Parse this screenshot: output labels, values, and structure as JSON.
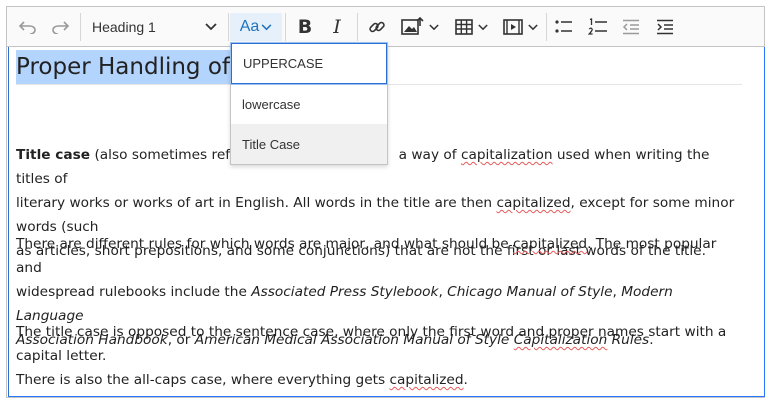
{
  "toolbar": {
    "undo_icon": "undo-icon",
    "redo_icon": "redo-icon",
    "heading_value": "Heading 1",
    "case_label": "Aa",
    "bold_label": "B",
    "italic_label": "I"
  },
  "case_menu": {
    "items": [
      {
        "label": "UPPERCASE"
      },
      {
        "label": "lowercase"
      },
      {
        "label": "Title Case"
      }
    ]
  },
  "document": {
    "title": "Proper Handling of T",
    "p1": {
      "bold": "Title case",
      "t1": " (also sometimes referre",
      "t2": "a way of ",
      "w_cap1": "capitalization",
      "t3": " used when writing the titles of",
      "t4": "literary works or works of art in English. All words in the title are then ",
      "w_cap2": "capitalized",
      "t5": ", except for some minor words (such",
      "t6": "as articles, short prepositions, and some conjunctions) that are not the first or last words of the title."
    },
    "p2": {
      "t1": "There are different rules for which words are major, and what should be ",
      "w_cap3": "capitalized",
      "t2": ". The most popular and",
      "t3": "widespread rulebooks include the ",
      "i1": "Associated Press Stylebook",
      "t4": ", ",
      "i2": "Chicago Manual of Style",
      "t5": ", ",
      "i3": "Modern Language",
      "i4": "Association Handbook",
      "t6": ", or ",
      "i5": "American Medical Association Manual of Style ",
      "i6": "Capitalization",
      "i7": " Rules",
      "t7": "."
    },
    "p3": {
      "t1": "The title case is opposed to the sentence case, where only the first word and proper names start with a capital letter.",
      "t2": "There is also the all-caps case, where everything gets ",
      "w_cap4": "capitalized",
      "t3": "."
    }
  }
}
